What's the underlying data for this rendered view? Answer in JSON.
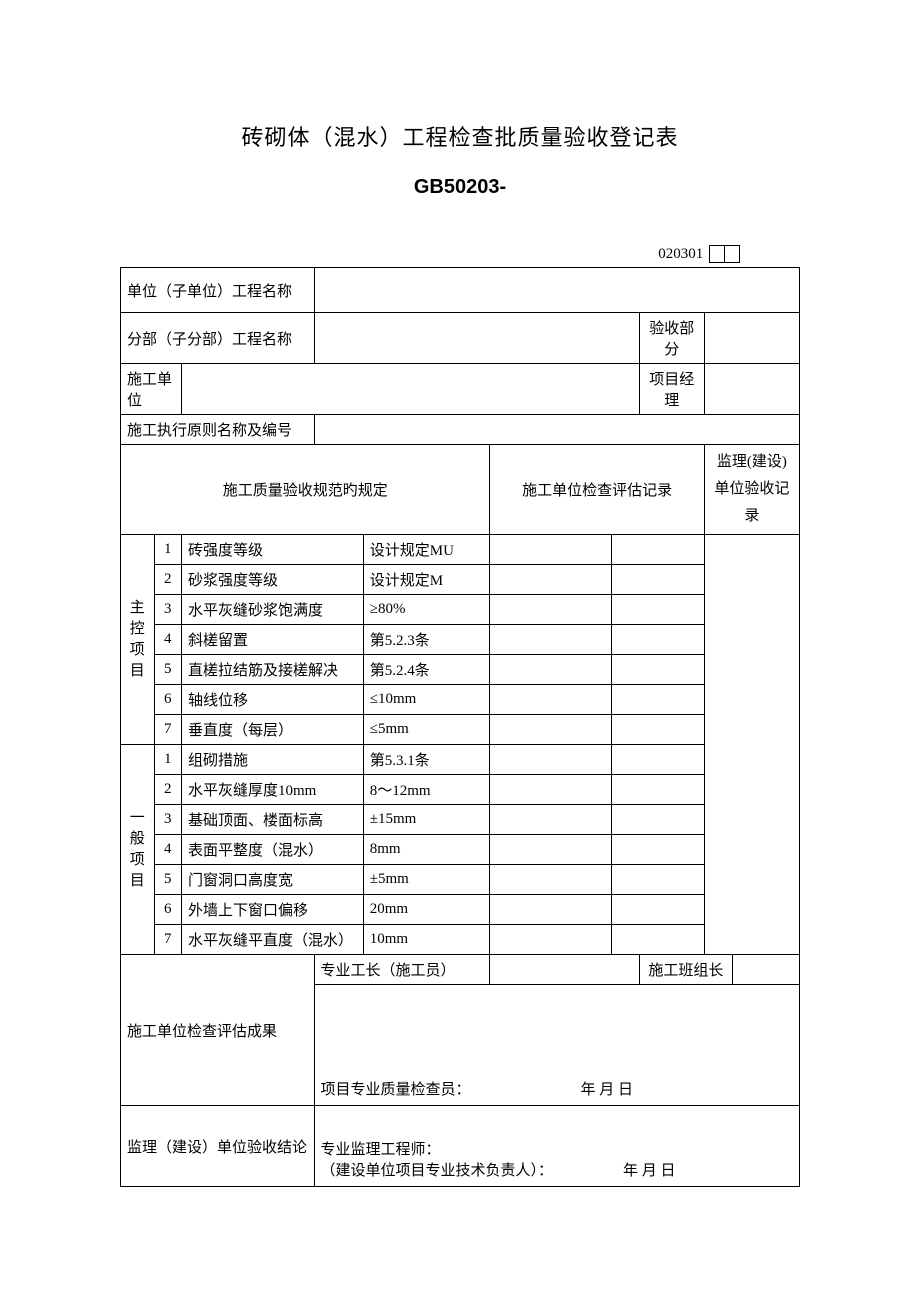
{
  "title": "砖砌体（混水）工程检查批质量验收登记表",
  "code": "GB50203-",
  "form_number": "020301",
  "header": {
    "unit_name_label": "单位（子单位）工程名称",
    "sub_name_label": "分部（子分部）工程名称",
    "accept_part_label": "验收部分",
    "construction_unit_label": "施工单位",
    "project_manager_label": "项目经理",
    "standard_label": "施工执行原则名称及编号"
  },
  "cols": {
    "spec_label": "施工质量验收规范旳规定",
    "check_record_label": "施工单位检查评估记录",
    "supervise_record_label": "监理(建设)单位验收记录"
  },
  "group_a": "主控项目",
  "group_b": "一般项目",
  "rows_a": [
    {
      "n": "1",
      "name": "砖强度等级",
      "spec": "设计规定MU"
    },
    {
      "n": "2",
      "name": "砂浆强度等级",
      "spec": "设计规定M"
    },
    {
      "n": "3",
      "name": "水平灰缝砂浆饱满度",
      "spec": "≥80%"
    },
    {
      "n": "4",
      "name": "斜槎留置",
      "spec": "第5.2.3条"
    },
    {
      "n": "5",
      "name": "直槎拉结筋及接槎解决",
      "spec": "第5.2.4条"
    },
    {
      "n": "6",
      "name": "轴线位移",
      "spec": "≤10mm"
    },
    {
      "n": "7",
      "name": "垂直度（每层）",
      "spec": "≤5mm"
    }
  ],
  "rows_b": [
    {
      "n": "1",
      "name": "组砌措施",
      "spec": "第5.3.1条"
    },
    {
      "n": "2",
      "name": "水平灰缝厚度10mm",
      "spec": "8～12mm"
    },
    {
      "n": "3",
      "name": "基础顶面、楼面标高",
      "spec": "±15mm"
    },
    {
      "n": "4",
      "name": "表面平整度（混水）",
      "spec": "8mm"
    },
    {
      "n": "5",
      "name": "门窗洞口高度宽",
      "spec": "±5mm"
    },
    {
      "n": "6",
      "name": "外墙上下窗口偏移",
      "spec": "20mm"
    },
    {
      "n": "7",
      "name": "水平灰缝平直度（混水）",
      "spec": "10mm"
    }
  ],
  "footer": {
    "foreman_label": "专业工长（施工员）",
    "team_leader_label": "施工班组长",
    "result_label": "施工单位检查评估成果",
    "inspector_line": "项目专业质量检查员：",
    "date1": "年  月  日",
    "conclusion_label": "监理（建设）单位验收结论",
    "engineer_line": "专业监理工程师：",
    "owner_line": "（建设单位项目专业技术负责人）：",
    "date2": "年  月  日"
  }
}
